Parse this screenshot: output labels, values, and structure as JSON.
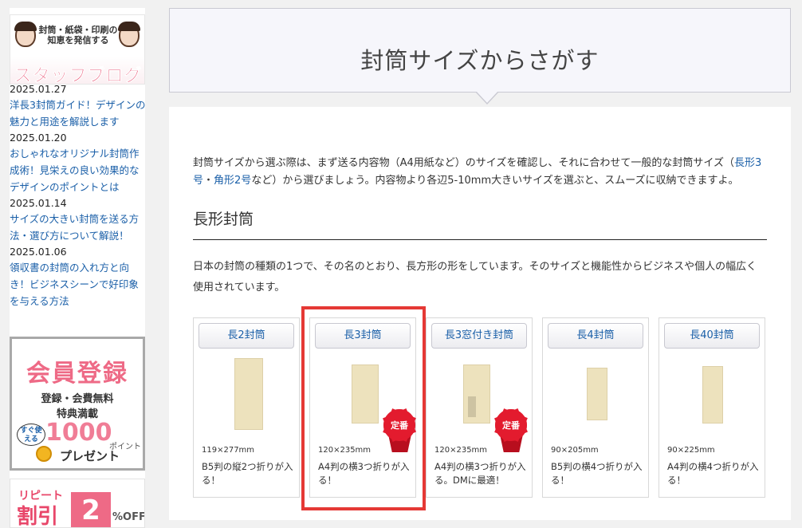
{
  "sidebar": {
    "blog_banner": {
      "tagline": "封筒・紙袋・印刷の知恵を発信する",
      "title": "スタッフブログ"
    },
    "news": [
      {
        "date": "2025.01.27",
        "title": "洋長3封筒ガイド！デザインの魅力と用途を解説します"
      },
      {
        "date": "2025.01.20",
        "title": "おしゃれなオリジナル封筒作成術！見栄えの良い効果的なデザインのポイントとは"
      },
      {
        "date": "2025.01.14",
        "title": "サイズの大きい封筒を送る方法・選び方について解説！"
      },
      {
        "date": "2025.01.06",
        "title": "領収書の封筒の入れ方と向き！ビジネスシーンで好印象を与える方法"
      }
    ],
    "member_banner": {
      "heading": "会員登録",
      "line1": "登録・会費無料",
      "line2": "特典満載",
      "note": "すぐ使える",
      "amount": "1000",
      "unit": "ポイント",
      "present": "プレゼント"
    },
    "repeat_banner": {
      "label": "リピート",
      "heading": "割引",
      "number": "2",
      "off": "%OFF"
    }
  },
  "main": {
    "page_title": "封筒サイズからさがす",
    "intro": {
      "before": "封筒サイズから選ぶ際は、まず送る内容物（A4用紙など）のサイズを確認し、それに合わせて一般的な封筒サイズ（",
      "link1": "長形3号",
      "sep": "・",
      "link2": "角形2号",
      "after": "など）から選びましょう。内容物より各辺5-10mm大きいサイズを選ぶと、スムーズに収納できますよ。"
    },
    "section": {
      "title": "長形封筒",
      "description": "日本の封筒の種類の1つで、その名のとおり、長方形の形をしています。そのサイズと機能性からビジネスや個人の幅広く使用されています。"
    },
    "badge_label": "定番",
    "cards": [
      {
        "name": "長2封筒",
        "size": "119×277mm",
        "desc": "B5判の縦2つ折りが入る！",
        "badge": false,
        "window": false
      },
      {
        "name": "長3封筒",
        "size": "120×235mm",
        "desc": "A4判の横3つ折りが入る！",
        "badge": true,
        "window": false
      },
      {
        "name": "長3窓付き封筒",
        "size": "120×235mm",
        "desc": "A4判の横3つ折りが入る。DMに最適！",
        "badge": true,
        "window": true
      },
      {
        "name": "長4封筒",
        "size": "90×205mm",
        "desc": "B5判の横4つ折りが入る！",
        "badge": false,
        "window": false
      },
      {
        "name": "長40封筒",
        "size": "90×225mm",
        "desc": "A4判の横4つ折りが入る！",
        "badge": false,
        "window": false
      }
    ]
  },
  "colors": {
    "link": "#1a5fa8",
    "highlight": "#e53935",
    "badge_red": "#e31b2e",
    "envelope": "#ede2bd",
    "accent_pink": "#ee6a86"
  }
}
